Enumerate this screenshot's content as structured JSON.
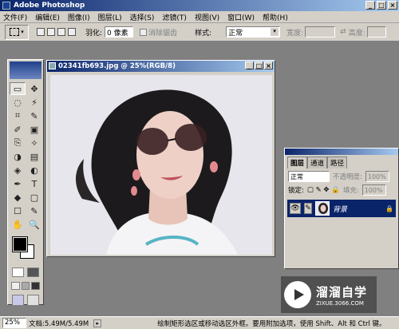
{
  "app": {
    "title": "Adobe Photoshop"
  },
  "window_buttons": [
    "_",
    "□",
    "×"
  ],
  "menu": [
    "文件(F)",
    "编辑(E)",
    "图像(I)",
    "图层(L)",
    "选择(S)",
    "滤镜(T)",
    "视图(V)",
    "窗口(W)",
    "帮助(H)"
  ],
  "options": {
    "feather_label": "羽化:",
    "feather_value": "0 像素",
    "antialias_label": "消除锯齿",
    "style_label": "样式:",
    "style_value": "正常",
    "width_label": "宽度:",
    "height_label": "高度:"
  },
  "document": {
    "title": "02341fb693.jpg @ 25%(RGB/8)"
  },
  "layers_panel": {
    "tabs": [
      "图层",
      "通道",
      "路径"
    ],
    "blend_mode": "正常",
    "opacity_label": "不透明度:",
    "opacity_value": "100%",
    "lock_label": "锁定:",
    "fill_label": "填充:",
    "fill_value": "100%",
    "layer_name": "背景"
  },
  "status": {
    "zoom": "25%",
    "doc_info": "文档:5.49M/5.49M",
    "hint": "绘制矩形选区或移动选区外框。要用附加选项，使用 Shift、Alt 和 Ctrl 键。"
  },
  "watermark": {
    "brand": "溜溜自学",
    "url": "ZIXUE.3066.COM"
  },
  "tools": [
    "▭",
    "✥",
    "◌",
    "⚡",
    "⌗",
    "✎",
    "✐",
    "▣",
    "⎘",
    "✧",
    "◑",
    "▤",
    "◈",
    "◐",
    "✒",
    "T",
    "◆",
    "▢",
    "☐",
    "✎",
    "✋",
    "🔍"
  ]
}
